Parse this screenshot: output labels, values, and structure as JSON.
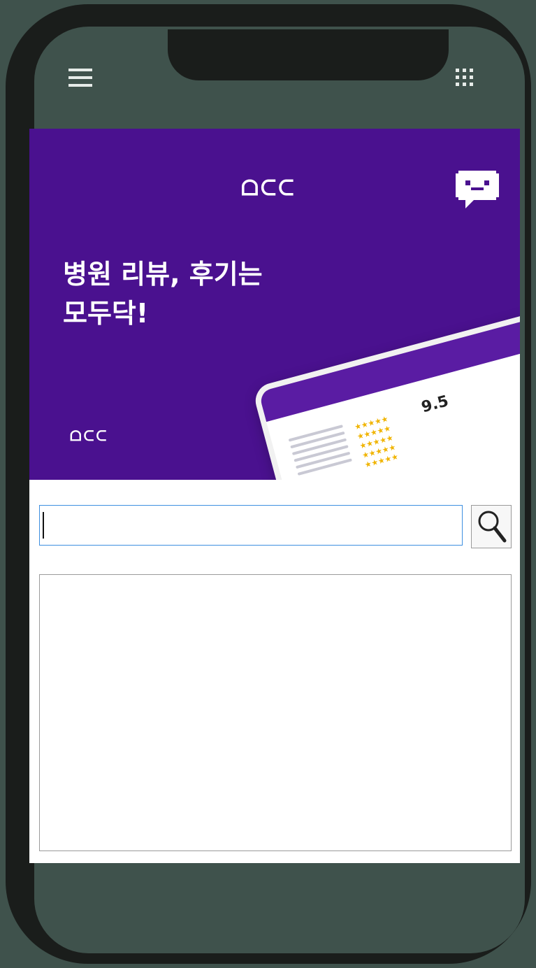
{
  "banner": {
    "logo": "ᗝᑕᑕ",
    "logo_small": "ᗝᑕᑕ",
    "headline_line1": "병원 리뷰, 후기는",
    "headline_line2": "모두닥!",
    "mock": {
      "score": "9.5"
    }
  },
  "search": {
    "placeholder": "",
    "value": ""
  },
  "colors": {
    "banner_bg": "#4a118f",
    "page_bg": "#3f524c",
    "frame": "#1a1d1b",
    "input_focus": "#3d8fe0"
  },
  "icons": {
    "menu": "hamburger-menu-icon",
    "apps": "grid-apps-icon",
    "chat": "chat-bubble-icon",
    "search": "magnifier-icon"
  }
}
